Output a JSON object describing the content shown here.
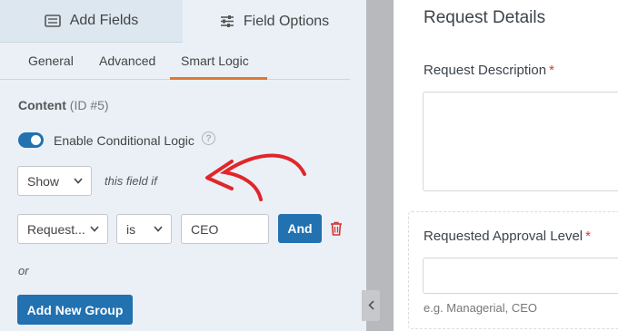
{
  "tabs": {
    "add_fields": "Add Fields",
    "field_options": "Field Options"
  },
  "subtabs": {
    "general": "General",
    "advanced": "Advanced",
    "smart_logic": "Smart Logic"
  },
  "field": {
    "name": "Content",
    "id_text": "(ID #5)"
  },
  "conditional_logic": {
    "toggle_label": "Enable Conditional Logic",
    "enabled": true,
    "action_value": "Show",
    "condition_text": "this field if",
    "rule": {
      "field_value": "Request...",
      "operator_value": "is",
      "value": "CEO"
    },
    "and_label": "And",
    "or_label": "or",
    "add_group_label": "Add New Group"
  },
  "preview": {
    "title": "Request Details",
    "description_label": "Request Description",
    "description_required": "*",
    "approval_label": "Requested Approval Level",
    "approval_required": "*",
    "approval_hint": "e.g. Managerial, CEO"
  },
  "colors": {
    "accent": "#2271b1",
    "tab_underline": "#e27730",
    "annotation_arrow": "#e0262a",
    "required": "#d63638"
  }
}
